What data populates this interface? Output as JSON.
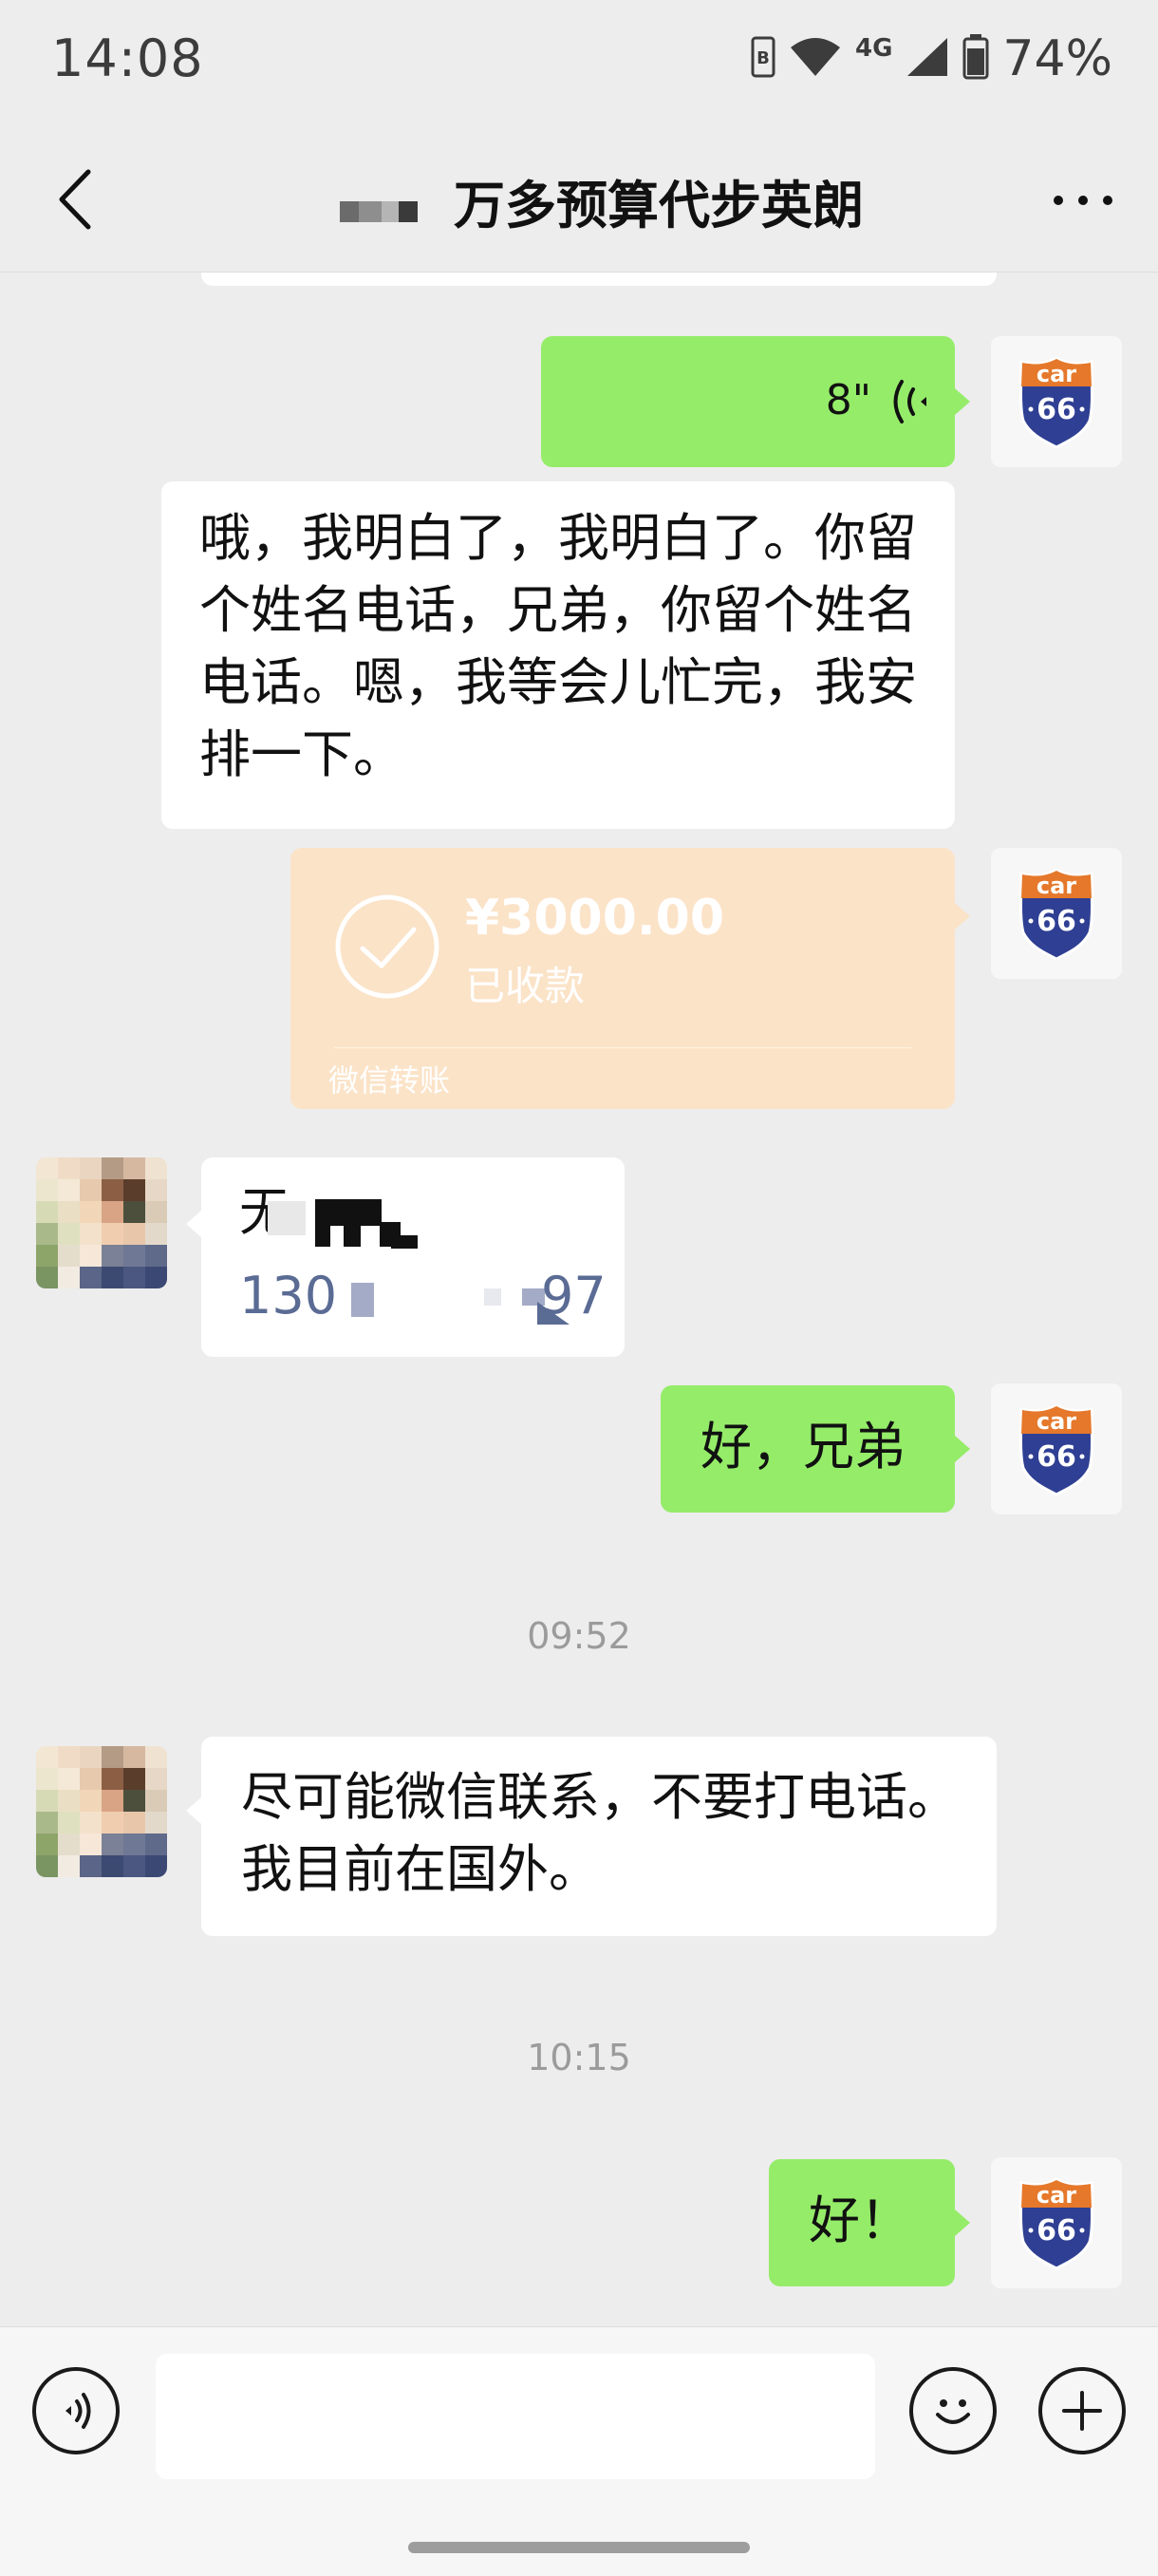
{
  "status_bar": {
    "time": "14:08",
    "network": "4G",
    "battery": "74%",
    "icons": [
      "hd-icon",
      "wifi-icon",
      "signal-icon",
      "battery-icon"
    ]
  },
  "nav": {
    "title": "万多预算代步英朗",
    "back_icon": "chevron-left-icon",
    "more_icon": "more-dots-icon"
  },
  "messages": {
    "voice": {
      "duration": "8\""
    },
    "reply_long": [
      "哦，我明白了，我明白了。你留",
      "个姓名电话，兄弟，你留个姓名",
      "电话。嗯，我等会儿忙完，我安",
      "排一下。"
    ],
    "transfer": {
      "amount": "¥3000.00",
      "status": "已收款",
      "footer": "微信转账"
    },
    "contact_card": {
      "line1": "无",
      "phone_start": "130",
      "phone_end": "97"
    },
    "ok_brother": "好，兄弟",
    "time_1": "09:52",
    "wechat_only": [
      "尽可能微信联系，不要打电话。",
      "我目前在国外。"
    ],
    "time_2": "10:15",
    "ok": "好！"
  },
  "avatar_me": {
    "top": "car",
    "number": "66"
  },
  "input_bar": {
    "voice_icon": "voice-mode-icon",
    "emoji_icon": "emoji-icon",
    "plus_icon": "plus-icon",
    "input_value": ""
  },
  "colors": {
    "background": "#ededed",
    "outgoing_bubble": "#95ec69",
    "incoming_bubble": "#ffffff",
    "transfer_card": "#fbe3c8"
  }
}
